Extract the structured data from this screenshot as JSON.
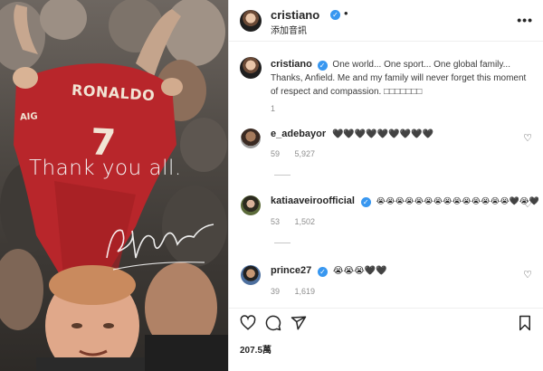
{
  "media": {
    "caption": "Thank you all.",
    "shirt_name": "RONALDO",
    "shirt_number": "7",
    "shirt_sponsor": "AIG",
    "signature_glyph": "signature"
  },
  "header": {
    "username": "cristiano",
    "separator": "•",
    "follow_label": "添加音訊",
    "more_icon": "•••"
  },
  "caption": {
    "username": "cristiano",
    "text": "One world... One sport... One global family... Thanks, Anfield. Me and my family will never forget this moment of respect and compassion. □□□□□□□",
    "meta_time": "1"
  },
  "comments": [
    {
      "username": "e_adebayor",
      "text": "🖤🖤🖤🖤🖤🖤🖤🖤🖤",
      "time": "59",
      "likes": "5,927",
      "verified": false
    },
    {
      "username": "katiaaveiroofficial",
      "text": "😭😭😭😭😭😭😭😭😭😭😭😭😭😭🖤😭🖤",
      "time": "53",
      "likes": "1,502",
      "verified": true
    },
    {
      "username": "prince27",
      "text": "😭😭😭🖤🖤",
      "time": "39",
      "likes": "1,619",
      "verified": true
    }
  ],
  "actions": {
    "like_icon": "heart-icon",
    "comment_icon": "comment-icon",
    "share_icon": "share-icon",
    "save_icon": "bookmark-icon"
  },
  "likes_count": "207.5萬"
}
